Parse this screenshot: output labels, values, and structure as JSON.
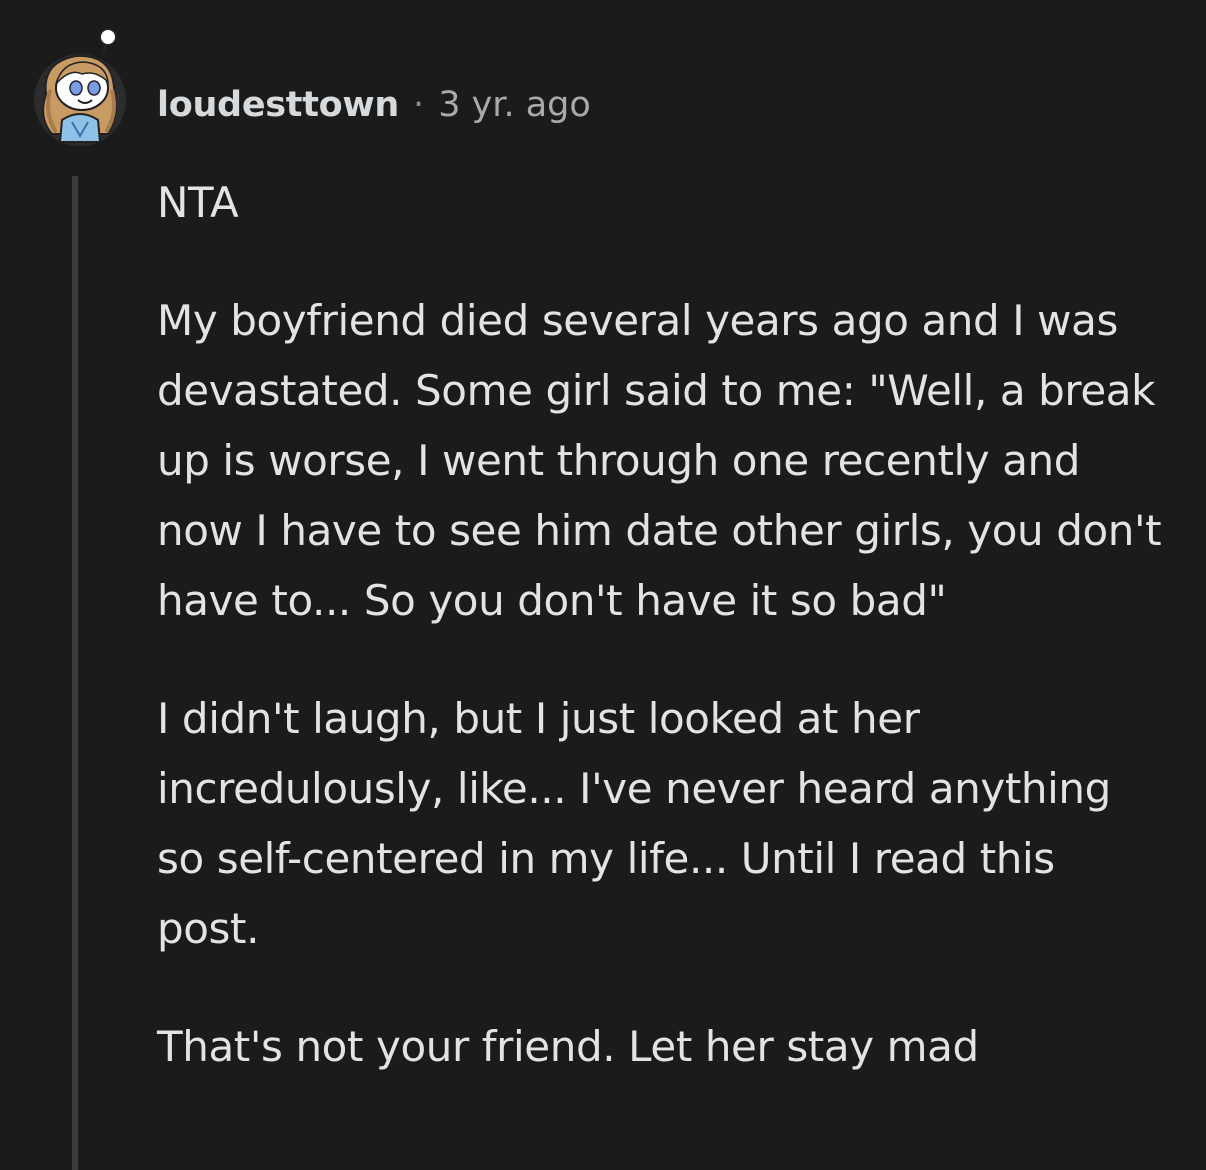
{
  "comment": {
    "username": "loudesttown",
    "separator": "·",
    "timestamp": "3 yr. ago",
    "avatar_icon": "snoo-avatar-icon",
    "paragraphs": [
      "NTA",
      "My boyfriend died several years ago and I was devastated. Some girl said to me: \"Well, a break up is worse, I went through one recently and now I have to see him date other girls, you don't have to... So you don't have it so bad\"",
      "I didn't laugh, but I just looked at her incredulously, like... I've never heard anything so self-centered in my life... Until I read this post.",
      "That's not your friend. Let her stay mad"
    ]
  },
  "colors": {
    "background": "#1b1b1c",
    "text": "#e3e3e3",
    "username": "#d7dadc",
    "timestamp": "#a7a9ab",
    "thread_line": "#3a3b3d"
  }
}
